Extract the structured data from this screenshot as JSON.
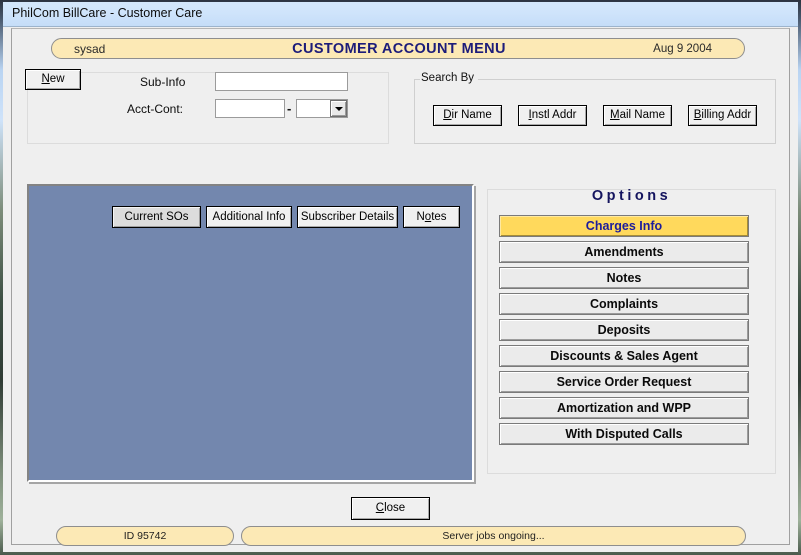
{
  "window": {
    "title": "PhilCom BillCare - Customer Care",
    "frame_gradient_colors": [
      "#2b3340",
      "#cfe3fa",
      "#3e5145",
      "#9fb29b"
    ]
  },
  "header": {
    "user": "sysad",
    "title": "CUSTOMER ACCOUNT MENU",
    "date": "Aug 9 2004",
    "pill_bg": "#fce9b5",
    "title_color": "#1c1c7a"
  },
  "subinfo": {
    "new_button": "New",
    "new_button_accel": "N",
    "sub_info_label": "Sub-Info",
    "sub_info_value": "",
    "sub_info_placeholder": "",
    "acct_cont_label": "Acct-Cont:",
    "acct_cont_value": "",
    "acct_cont_placeholder": "",
    "separator": "-",
    "cont_suffix_value": "",
    "cont_dropdown_icon": "chevron-down-icon"
  },
  "search_by": {
    "legend": "Search By",
    "buttons": [
      {
        "label": "Dir Name",
        "accel": "D"
      },
      {
        "label": "Instl Addr",
        "accel": "I"
      },
      {
        "label": "Mail Name",
        "accel": "M"
      },
      {
        "label": "Billing Addr",
        "accel": "B"
      }
    ]
  },
  "content": {
    "panel_color": "#7387ae",
    "tabs": [
      {
        "label": "Current SOs",
        "active": true,
        "accel": ""
      },
      {
        "label": "Additional Info",
        "active": false,
        "accel": ""
      },
      {
        "label": "Subscriber Details",
        "active": false,
        "accel": ""
      },
      {
        "label": "Notes",
        "active": false,
        "accel": "o"
      }
    ]
  },
  "options": {
    "title": "Options",
    "selected_bg": "#ffd95c",
    "selected_text_color": "#1c1c9c",
    "items": [
      {
        "label": "Charges Info",
        "selected": true
      },
      {
        "label": "Amendments",
        "selected": false
      },
      {
        "label": "Notes",
        "selected": false
      },
      {
        "label": "Complaints",
        "selected": false
      },
      {
        "label": "Deposits",
        "selected": false
      },
      {
        "label": "Discounts & Sales Agent",
        "selected": false
      },
      {
        "label": "Service Order Request",
        "selected": false
      },
      {
        "label": "Amortization and WPP",
        "selected": false
      },
      {
        "label": "With Disputed Calls",
        "selected": false
      }
    ]
  },
  "footer": {
    "close_label": "Close",
    "close_accel": "C",
    "status_id": "ID 95742",
    "status_server": "Server jobs ongoing..."
  }
}
